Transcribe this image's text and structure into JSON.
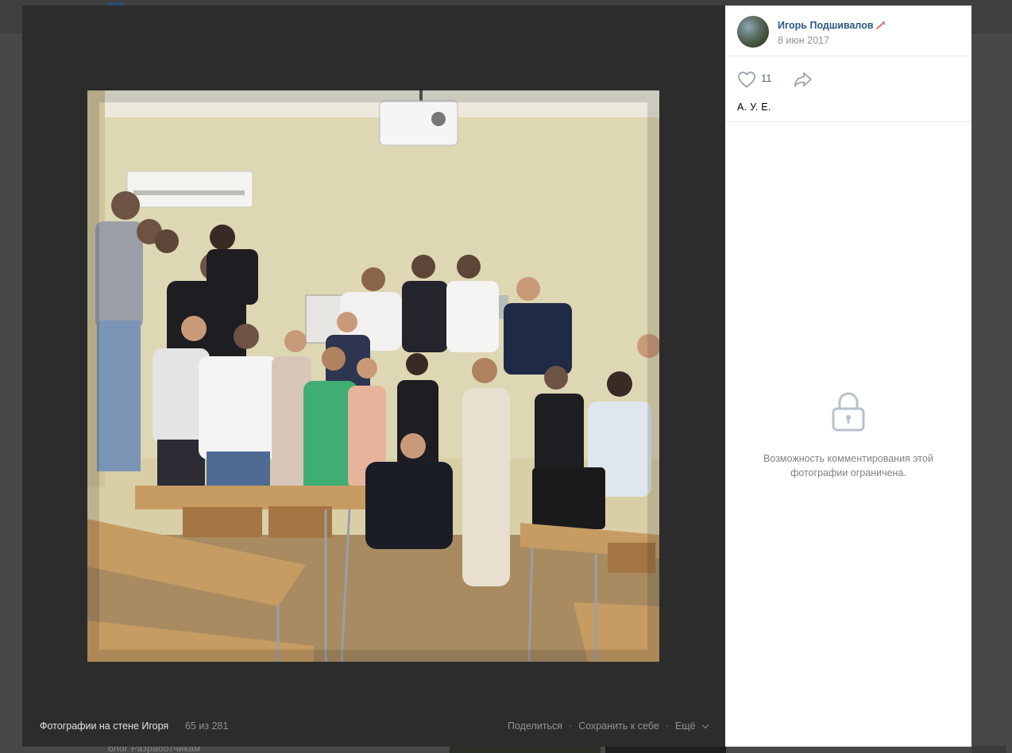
{
  "background_page": {
    "footer_text": "блог Разработчикам"
  },
  "post": {
    "author_name": "Игорь Подшивалов",
    "date": "8 июн 2017",
    "likes": "11",
    "caption": "А. У. Е.",
    "comments_restricted_text": "Возможность комментирования этой фотографии ограничена."
  },
  "viewer": {
    "album_title": "Фотографии на стене Игоря",
    "position_counter": "65 из 281",
    "actions": {
      "share": "Поделиться",
      "save": "Сохранить к себе",
      "more": "Ещё"
    }
  },
  "icons": {
    "author_badge": "pen-icon",
    "like": "heart-icon",
    "share": "share-arrow-icon",
    "comments_lock": "lock-icon",
    "more": "chevron-down-icon"
  },
  "colors": {
    "link_blue": "#2a5885",
    "muted_gray": "#939393",
    "viewer_bg": "#2c2c2c",
    "icon_gray": "#99a2ad"
  }
}
